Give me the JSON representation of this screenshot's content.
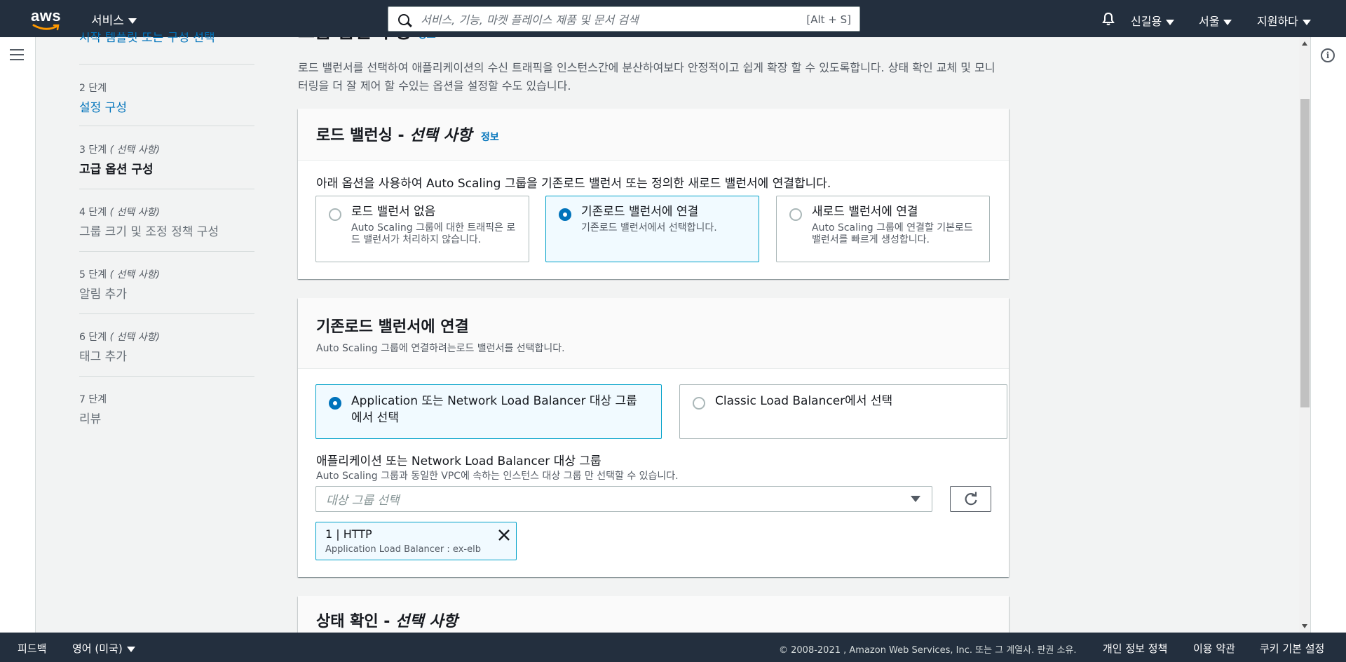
{
  "nav": {
    "logo": "aws",
    "services": "서비스",
    "search_placeholder": "서비스, 기능, 마켓 플레이스 제품 및 문서 검색",
    "search_shortcut": "[Alt + S]",
    "user": "신길용",
    "region": "서울",
    "support": "지원하다"
  },
  "steps": {
    "step1_title": "시작 템플릿 또는 구성 선택",
    "step2_num": "2 단계",
    "step2_title": "설정 구성",
    "step3_num": "3 단계",
    "step3_opt": "( 선택 사항)",
    "step3_title": "고급 옵션 구성",
    "step4_num": "4 단계",
    "step4_opt": "( 선택 사항)",
    "step4_title": "그룹 크기 및 조정 정책 구성",
    "step5_num": "5 단계",
    "step5_opt": "( 선택 사항)",
    "step5_title": "알림 추가",
    "step6_num": "6 단계",
    "step6_opt": "( 선택 사항)",
    "step6_title": "태그 추가",
    "step7_num": "7 단계",
    "step7_title": "리뷰"
  },
  "main": {
    "page_heading": "고급 옵션 구성",
    "page_heading_info": "정보",
    "intro": "로드 밸런서를 선택하여 애플리케이션의 수신 트래픽을 인스턴스간에 분산하여보다 안정적이고 쉽게 확장 할 수 있도록합니다. 상태 확인 교체 및 모니터링을 더 잘 제어 할 수있는 옵션을 설정할 수도 있습니다."
  },
  "lb_card": {
    "title": "로드 밸런싱 -",
    "title_optional": "선택 사항",
    "info": "정보",
    "desc": "아래 옵션을 사용하여 Auto Scaling 그룹을 기존로드 밸런서 또는 정의한 새로드 밸런서에 연결합니다.",
    "option1_label": "로드 밸런서 없음",
    "option1_desc": "Auto Scaling 그룹에 대한 트래픽은 로드 밸런서가 처리하지 않습니다.",
    "option2_label": "기존로드 밸런서에 연결",
    "option2_desc": "기존로드 밸런서에서 선택합니다.",
    "option3_label": "새로드 밸런서에 연결",
    "option3_desc": "Auto Scaling 그룹에 연결할 기본로드 밸런서를 빠르게 생성합니다."
  },
  "attach_card": {
    "title": "기존로드 밸런서에 연결",
    "subtitle": "Auto Scaling 그룹에 연결하려는로드 밸런서를 선택합니다.",
    "option1_label": "Application 또는 Network Load Balancer 대상 그룹에서 선택",
    "option2_label": "Classic Load Balancer에서 선택",
    "field_label": "애플리케이션 또는 Network Load Balancer 대상 그룹",
    "field_desc": "Auto Scaling 그룹과 동일한 VPC에 속하는 인스턴스 대상 그룹 만 선택할 수 있습니다.",
    "select_placeholder": "대상 그룹 선택",
    "token_title": "1 | HTTP",
    "token_desc": "Application Load Balancer : ex-elb"
  },
  "health_card": {
    "title": "상태 확인 -",
    "title_optional": "선택 사항"
  },
  "footer": {
    "feedback": "피드백",
    "language": "영어 (미국)",
    "copyright": "© 2008-2021 , Amazon Web Services, Inc. 또는 그 계열사. 판권 소유.",
    "privacy": "개인 정보 정책",
    "terms": "이용 약관",
    "cookies": "쿠키 기본 설정"
  }
}
